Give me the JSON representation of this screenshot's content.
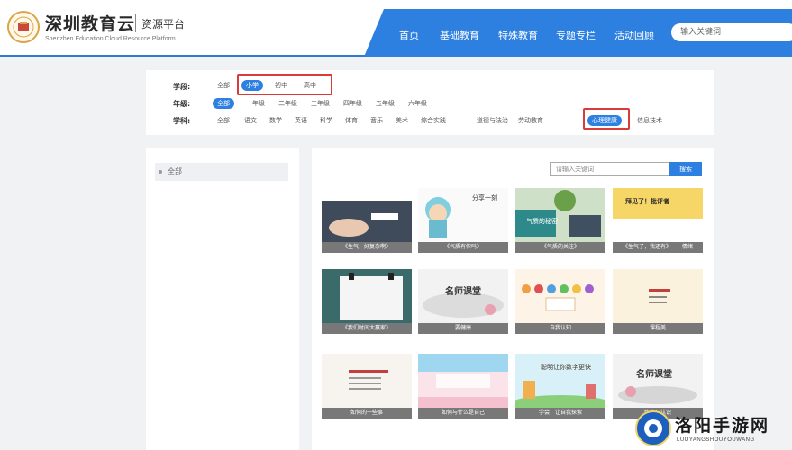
{
  "header": {
    "brand_title": "深圳教育云",
    "brand_sub": "资源平台",
    "brand_en": "Shenzhen Education Cloud Resource Platform",
    "nav": [
      "首页",
      "基础教育",
      "特殊教育",
      "专题专栏",
      "活动回顾"
    ],
    "search_placeholder": "输入关键词"
  },
  "filters": {
    "stage_label": "学段:",
    "stage_options": [
      "全部",
      "小学",
      "初中",
      "高中"
    ],
    "grade_label": "年级:",
    "grade_options": [
      "全部",
      "一年级",
      "二年级",
      "三年级",
      "四年级",
      "五年级",
      "六年级"
    ],
    "subject_label": "学科:",
    "subject_options": [
      "全部",
      "语文",
      "数学",
      "英语",
      "科学",
      "体育",
      "音乐",
      "美术",
      "综合实践",
      "道德与法治",
      "劳动教育",
      "心理健康",
      "信息技术"
    ]
  },
  "sidebar": {
    "items": [
      "全部"
    ]
  },
  "main": {
    "search_placeholder": "请输入关键词",
    "search_button": "搜索",
    "cards": [
      "《生气，好复杂啊》",
      "《气质有你吗》",
      "《气质的关注》",
      "《生气了，我还有》——情绪",
      "《我们时间大赢家》",
      "要健康",
      "自我认知",
      "课程美",
      "如何的一些事",
      "如何与什么是自己",
      "学会，让自我探索",
      "情绪与认识"
    ],
    "thumb_texts": {
      "c2": "分享一刻",
      "c3": "气质的秘密",
      "c4": "拜见了！批评者",
      "c6": "名师课堂",
      "c11": "聪明让你数字更快",
      "c12": "名师课堂"
    }
  },
  "watermark": {
    "text": "洛阳手游网",
    "en": "LUOYANGSHOUYOUWANG"
  },
  "colors": {
    "accent": "#2e80e0",
    "highlight": "#d93a3a"
  }
}
